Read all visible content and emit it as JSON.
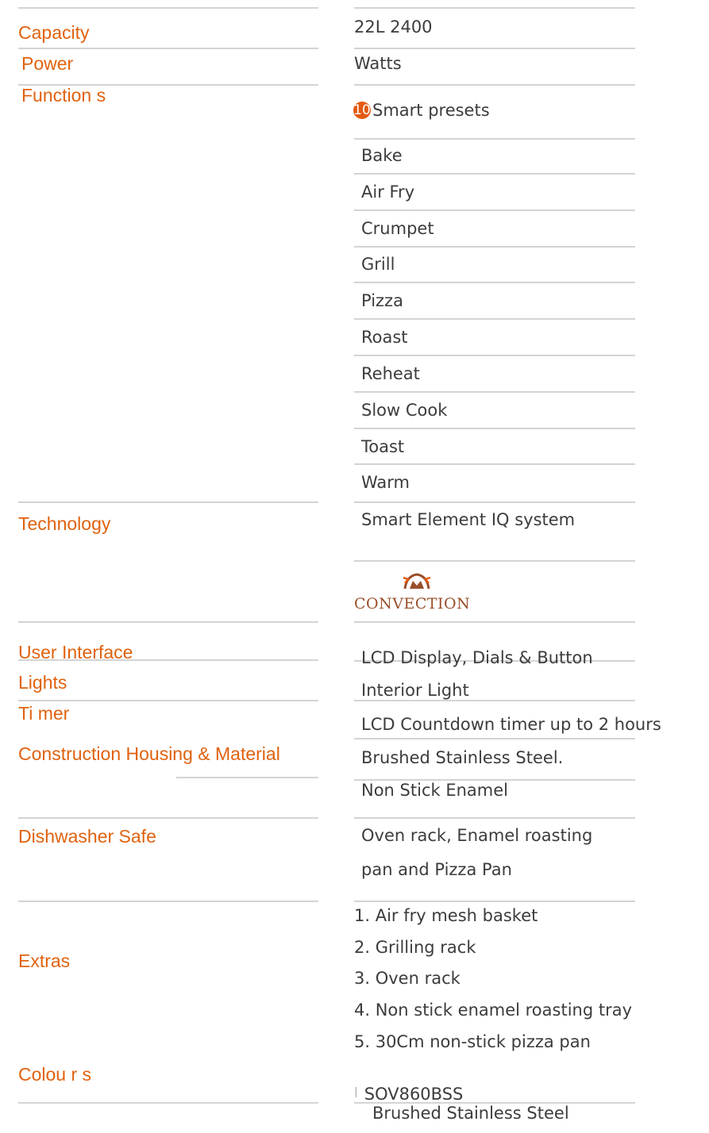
{
  "labels": {
    "capacity": "Capacity",
    "power": "Power",
    "functions": "Function s",
    "technology": "Technology",
    "user_interface": "User Interface",
    "lights": "Lights",
    "timer": "Ti mer",
    "construction": "Construction Housing & Material",
    "dishwasher": "Dishwasher Safe",
    "extras": "Extras",
    "colours": "Colou r s"
  },
  "values": {
    "capacity": "22L 2400",
    "power": "Watts",
    "presets_count": "10",
    "presets_label": "Smart presets",
    "functions": [
      "Bake",
      "Air Fry",
      "Crumpet",
      "Grill",
      "Pizza",
      "Roast",
      "Reheat",
      "Slow Cook",
      "Toast",
      "Warm"
    ],
    "technology": "Smart Element IQ system",
    "convection_logo": "CONVECTION",
    "user_interface": "LCD Display, Dials & Button",
    "lights": "Interior Light",
    "timer": "LCD Countdown timer up to 2 hours",
    "construction_housing": "Brushed Stainless Steel.",
    "construction_material": "Non Stick Enamel",
    "dishwasher": [
      "Oven rack, Enamel roasting",
      "pan and Pizza Pan"
    ],
    "extras": [
      "1. Air fry mesh basket",
      "2. Grilling rack",
      "3. Oven rack",
      "4. Non stick enamel roasting tray",
      "5. 30Cm non-stick pizza pan"
    ],
    "colour_model": "SOV860BSS",
    "colour_name": "Brushed Stainless Steel"
  },
  "colors": {
    "label": "#e0620f",
    "value": "#3c3c3c",
    "rule": "#d4d4d4",
    "badge": "#e45a12",
    "logo": "#9a4f2a"
  },
  "icons": {
    "convection": "convection-fan-icon",
    "colour_bullet": "swatch-bullet-icon"
  }
}
